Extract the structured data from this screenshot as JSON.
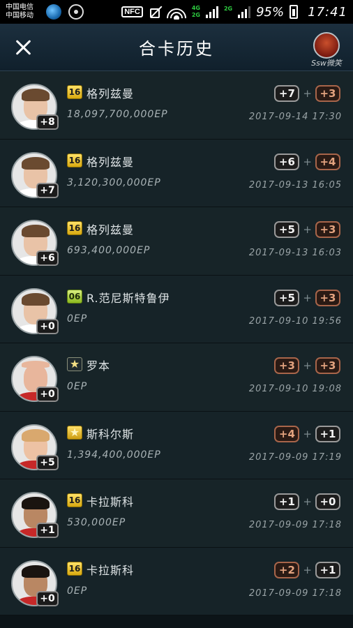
{
  "statusbar": {
    "carrier1": "中国电信",
    "carrier2": "中国移动",
    "nfc": "NFC",
    "net_top": "4G",
    "net_bottom": "2G",
    "net2": "2G",
    "battery": "95%",
    "time": "17:41"
  },
  "header": {
    "title": "合卡历史",
    "user_name": "Ssw微笑"
  },
  "records": [
    {
      "level": "+8",
      "season": "16",
      "season_type": "s16",
      "name": "格列兹曼",
      "ep": "18,097,700,000EP",
      "left": "+7",
      "left_color": "w",
      "right": "+3",
      "right_color": "o",
      "date": "2017-09-14  17:30",
      "avatar": "fair"
    },
    {
      "level": "+7",
      "season": "16",
      "season_type": "s16",
      "name": "格列兹曼",
      "ep": "3,120,300,000EP",
      "left": "+6",
      "left_color": "w",
      "right": "+4",
      "right_color": "o",
      "date": "2017-09-13  16:05",
      "avatar": "fair"
    },
    {
      "level": "+6",
      "season": "16",
      "season_type": "s16",
      "name": "格列兹曼",
      "ep": "693,400,000EP",
      "left": "+5",
      "left_color": "w",
      "right": "+3",
      "right_color": "o",
      "date": "2017-09-13  16:03",
      "avatar": "fair"
    },
    {
      "level": "+0",
      "season": "06",
      "season_type": "s06",
      "name": "R.范尼斯特鲁伊",
      "ep": "0EP",
      "left": "+5",
      "left_color": "w",
      "right": "+3",
      "right_color": "o",
      "date": "2017-09-10  19:56",
      "avatar": "brown"
    },
    {
      "level": "+0",
      "season": "★",
      "season_type": "star",
      "name": "罗本",
      "ep": "0EP",
      "left": "+3",
      "left_color": "o",
      "right": "+3",
      "right_color": "o",
      "date": "2017-09-10  19:08",
      "avatar": "bald"
    },
    {
      "level": "+5",
      "season": "★",
      "season_type": "gstar",
      "name": "斯科尔斯",
      "ep": "1,394,400,000EP",
      "left": "+4",
      "left_color": "o",
      "right": "+1",
      "right_color": "w",
      "date": "2017-09-09  17:19",
      "avatar": "ginger"
    },
    {
      "level": "+1",
      "season": "16",
      "season_type": "s16",
      "name": "卡拉斯科",
      "ep": "530,000EP",
      "left": "+1",
      "left_color": "w",
      "right": "+0",
      "right_color": "w",
      "date": "2017-09-09  17:18",
      "avatar": "dark"
    },
    {
      "level": "+0",
      "season": "16",
      "season_type": "s16",
      "name": "卡拉斯科",
      "ep": "0EP",
      "left": "+2",
      "left_color": "o",
      "right": "+1",
      "right_color": "w",
      "date": "2017-09-09  17:18",
      "avatar": "dark"
    }
  ],
  "icons": {
    "close": "close-icon",
    "globe": "globe-icon",
    "disc": "disc-icon",
    "mute": "mute-icon",
    "wifi": "wifi-icon",
    "signal": "signal-icon",
    "battery": "battery-icon"
  }
}
